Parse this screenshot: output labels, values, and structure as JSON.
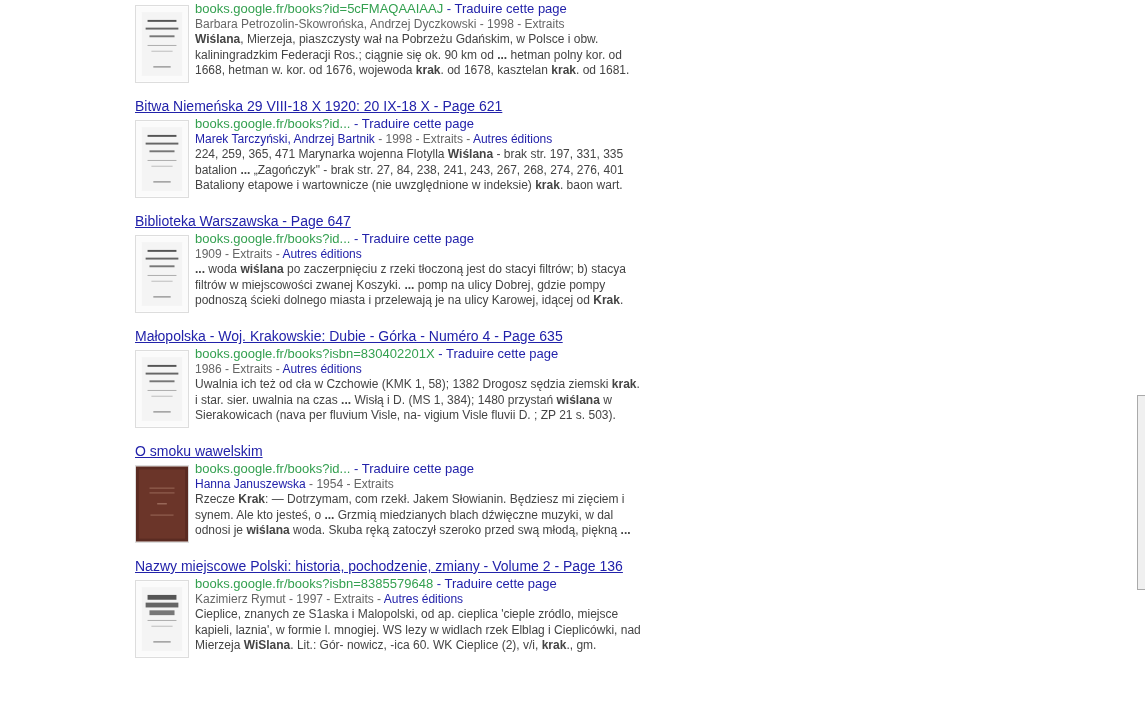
{
  "results": [
    {
      "url": "books.google.fr/books?id=5cFMAQAAIAAJ",
      "translate": "- Traduire cette page",
      "meta": [
        {
          "text": "Barbara Petrozolin-Skowrońska, Andrzej Dyczkowski - 1998 - Extraits",
          "link": false
        }
      ],
      "snippet": "**Wiślana**, Mierzeja, piaszczysty wał na Pobrzeżu Gdańskim, w Polsce i obw. kaliningradzkim Federacji Ros.; ciągnie się ok. 90 km od **...** hetman polny kor. od 1668, hetman w. kor. od 1676, wojewoda **krak**. od 1678, kasztelan **krak**. od 1681.",
      "kind": "light"
    },
    {
      "title": "Bitwa Niemeńska 29 VIII-18 X 1920: 20 IX-18 X - Page 621",
      "url": "books.google.fr/books?id...",
      "translate": "- Traduire cette page",
      "meta": [
        {
          "text": "Marek Tarczyński, Andrzej Bartnik",
          "link": true
        },
        {
          "text": " - 1998 - Extraits - ",
          "link": false
        },
        {
          "text": "Autres éditions",
          "link": true
        }
      ],
      "snippet": "224, 259, 365, 471 Marynarka wojenna Flotylla **Wiślana** - brak str. 197, 331, 335 batalion **...** „Zagończyk\" - brak str. 27, 84, 238, 241, 243, 267, 268, 274, 276, 401 Bataliony etapowe i wartownicze (nie uwzględnione w indeksie) **krak**. baon wart.",
      "kind": "light"
    },
    {
      "title": "Biblioteka Warszawska - Page 647",
      "url": "books.google.fr/books?id...",
      "translate": "- Traduire cette page",
      "meta": [
        {
          "text": "1909 - Extraits - ",
          "link": false
        },
        {
          "text": "Autres éditions",
          "link": true
        }
      ],
      "snippet": "**...** woda **wiślana** po zaczerpnięciu z rzeki tłoczoną jest do stacyi filtrów; b) stacya filtrów w miejscowości zwanej Koszyki. **...** pomp na ulicy Dobrej, gdzie pompy podnoszą ścieki dolnego miasta i przelewają je na ulicy Karowej, idącej od **Krak**.",
      "kind": "light"
    },
    {
      "title": "Małopolska - Woj. Krakowskie: Dubie - Górka - Numéro 4 - Page 635",
      "url": "books.google.fr/books?isbn=830402201X",
      "translate": "- Traduire cette page",
      "meta": [
        {
          "text": "1986 - Extraits - ",
          "link": false
        },
        {
          "text": "Autres éditions",
          "link": true
        }
      ],
      "snippet": "Uwalnia ich też od cła w Czchowie (KMK 1, 58); 1382 Drogosz sędzia ziemski **krak**. i star. sier. uwalnia na czas **...** Wisłą i D. (MS 1, 384); 1480 przystań **wiślana** w Sierakowicach (nava per fluvium Visle, na- vigium Visle fluvii D. ; ZP 21 s. 503).",
      "kind": "light"
    },
    {
      "title": "O smoku wawelskim",
      "url": "books.google.fr/books?id...",
      "translate": "- Traduire cette page",
      "meta": [
        {
          "text": "Hanna Januszewska",
          "link": true
        },
        {
          "text": " - 1954 - Extraits",
          "link": false
        }
      ],
      "snippet": "Rzecze **Krak**: — Dotrzymam, com rzekł. Jakem Słowianin. Będziesz mi zięciem i synem. Ale kto jesteś, o **...** Grzmią miedzianych blach dźwięczne muzyki, w dal odnosi je **wiślana** woda. Skuba ręką zatoczył szeroko przed swą młodą, piękną **...**",
      "kind": "dark"
    },
    {
      "title": "Nazwy miejscowe Polski: historia, pochodzenie, zmiany - Volume 2 - Page 136",
      "url": "books.google.fr/books?isbn=8385579648",
      "translate": "- Traduire cette page",
      "meta": [
        {
          "text": "Kazimierz Rymut - 1997 - Extraits - ",
          "link": false
        },
        {
          "text": "Autres éditions",
          "link": true
        }
      ],
      "snippet": "Cieplice, znanych ze S1aska i Malopolski, od ap. cieplica 'cieple zródlo, miejsce kapieli, laznia', w formie l. mnogiej. WS lezy w widlach rzek Elblag i Cieplicówki, nad Mierzeja **WiSlana**. Lit.: Gór- nowicz, -ica 60. WK Cieplice (2), v/i, **krak**., gm.",
      "kind": "bold"
    }
  ]
}
